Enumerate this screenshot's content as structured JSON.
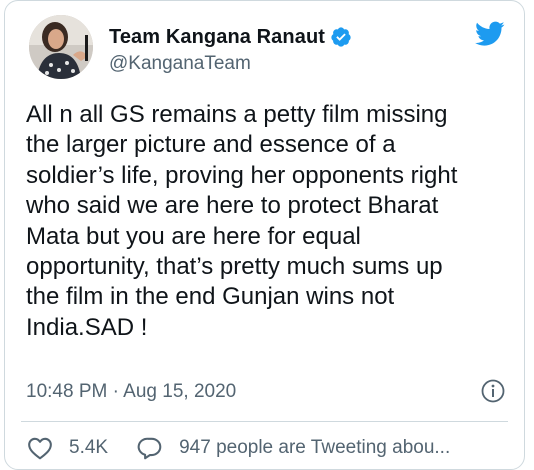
{
  "author": {
    "name": "Team Kangana Ranaut",
    "handle": "@KanganaTeam"
  },
  "tweet": {
    "text": "All n all GS remains a petty film missing\nthe larger picture and essence of a\nsoldier’s life, proving her opponents right\nwho said we are here to protect Bharat\nMata but you are here for equal\nopportunity, that’s pretty much sums up\nthe film in the end Gunjan wins not\nIndia.SAD !",
    "timestamp": "10:48 PM · Aug 15, 2020"
  },
  "actions": {
    "likes": "5.4K",
    "replies": "947 people are Tweeting abou..."
  },
  "icons": {
    "verified": "verified-badge-icon",
    "brand": "twitter-bird-icon",
    "info": "info-icon",
    "like": "heart-icon",
    "reply": "speech-bubble-icon"
  },
  "colors": {
    "brand_blue": "#1d9bf0",
    "text_primary": "#0f1419",
    "text_secondary": "#536471",
    "border": "#cfd9de"
  }
}
